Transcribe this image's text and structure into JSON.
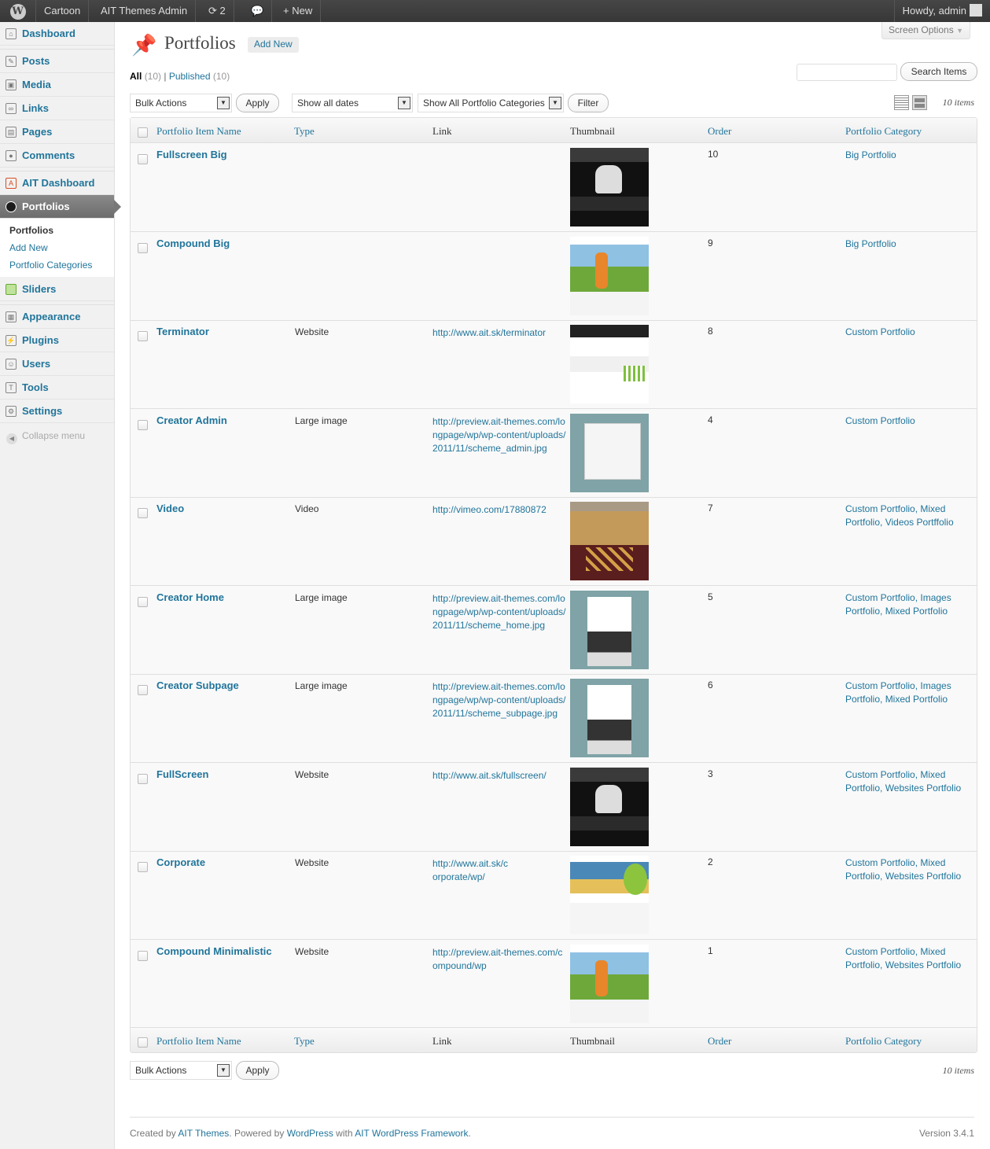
{
  "adminbar": {
    "site": "Cartoon",
    "theme_admin": "AIT Themes Admin",
    "updates_count": "2",
    "new_label": "New",
    "howdy": "Howdy, admin"
  },
  "sidebar": {
    "items": [
      {
        "label": "Dashboard"
      },
      {
        "label": "Posts"
      },
      {
        "label": "Media"
      },
      {
        "label": "Links"
      },
      {
        "label": "Pages"
      },
      {
        "label": "Comments"
      },
      {
        "label": "AIT Dashboard"
      },
      {
        "label": "Portfolios"
      },
      {
        "label": "Sliders"
      },
      {
        "label": "Appearance"
      },
      {
        "label": "Plugins"
      },
      {
        "label": "Users"
      },
      {
        "label": "Tools"
      },
      {
        "label": "Settings"
      }
    ],
    "submenu": [
      "Portfolios",
      "Add New",
      "Portfolio Categories"
    ],
    "collapse": "Collapse menu"
  },
  "header": {
    "title": "Portfolios",
    "add_new": "Add New",
    "screen_options": "Screen Options"
  },
  "filters": {
    "all_label": "All",
    "all_count": "(10)",
    "published_label": "Published",
    "published_count": "(10)",
    "search_button": "Search Items",
    "bulk_actions": "Bulk Actions",
    "apply": "Apply",
    "dates": "Show all dates",
    "categories": "Show All Portfolio Categories",
    "filter": "Filter",
    "items_count": "10 items"
  },
  "table": {
    "columns": [
      "Portfolio Item Name",
      "Type",
      "Link",
      "Thumbnail",
      "Order",
      "Portfolio Category"
    ],
    "rows": [
      {
        "name": "Fullscreen Big",
        "type": "",
        "link": "",
        "order": "10",
        "category": "Big Portfolio"
      },
      {
        "name": "Compound Big",
        "type": "",
        "link": "",
        "order": "9",
        "category": "Big Portfolio"
      },
      {
        "name": "Terminator",
        "type": "Website",
        "link": "http://www.ait.sk/terminator",
        "order": "8",
        "category": "Custom Portfolio"
      },
      {
        "name": "Creator Admin",
        "type": "Large image",
        "link": "http://preview.ait-themes.com/longpage/wp/wp-content/uploads/2011/11/scheme_admin.jpg",
        "order": "4",
        "category": "Custom Portfolio"
      },
      {
        "name": "Video",
        "type": "Video",
        "link": "http://vimeo.com/17880872",
        "order": "7",
        "category": "Custom Portfolio, Mixed Portfolio, Videos Portffolio"
      },
      {
        "name": "Creator Home",
        "type": "Large image",
        "link": "http://preview.ait-themes.com/longpage/wp/wp-content/uploads/2011/11/scheme_home.jpg",
        "order": "5",
        "category": "Custom Portfolio, Images Portfolio, Mixed Portfolio"
      },
      {
        "name": "Creator Subpage",
        "type": "Large image",
        "link": "http://preview.ait-themes.com/longpage/wp/wp-content/uploads/2011/11/scheme_subpage.jpg",
        "order": "6",
        "category": "Custom Portfolio, Images Portfolio, Mixed Portfolio"
      },
      {
        "name": "FullScreen",
        "type": "Website",
        "link": "http://www.ait.sk/fullscreen/",
        "order": "3",
        "category": "Custom Portfolio, Mixed Portfolio, Websites Portfolio"
      },
      {
        "name": "Corporate",
        "type": "Website",
        "link": "http://www.ait.sk/corporate/wp/",
        "order": "2",
        "category": "Custom Portfolio, Mixed Portfolio, Websites Portfolio"
      },
      {
        "name": "Compound Minimalistic",
        "type": "Website",
        "link": "http://preview.ait-themes.com/compound/wp",
        "order": "1",
        "category": "Custom Portfolio, Mixed Portfolio, Websites Portfolio"
      }
    ]
  },
  "footer": {
    "created_by": "Created by",
    "ait_themes": "AIT Themes",
    "powered_by": ". Powered by",
    "wordpress": "WordPress",
    "with": "with",
    "framework": "AIT WordPress Framework",
    "end": ".",
    "version": "Version 3.4.1"
  }
}
